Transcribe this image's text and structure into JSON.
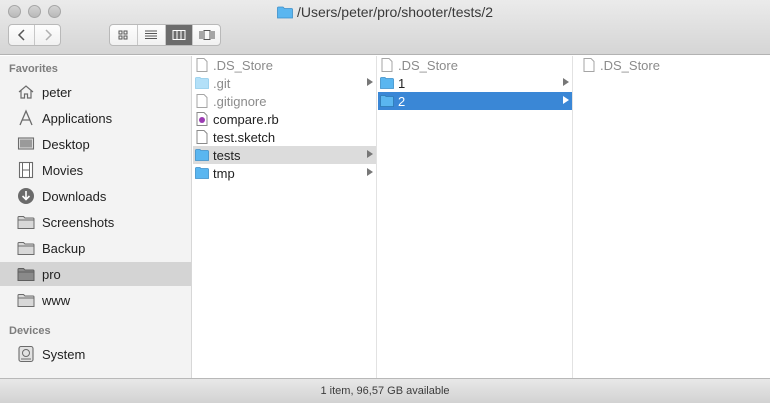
{
  "window": {
    "title": "/Users/peter/pro/shooter/tests/2"
  },
  "toolbar": {
    "nav": [
      {
        "icon": "chevron-left-icon"
      },
      {
        "icon": "chevron-right-icon"
      }
    ],
    "views": [
      {
        "icon": "icon-view-icon",
        "active": false
      },
      {
        "icon": "list-view-icon",
        "active": false
      },
      {
        "icon": "column-view-icon",
        "active": true
      },
      {
        "icon": "cover-flow-icon",
        "active": false
      }
    ]
  },
  "sidebar": {
    "favorites_label": "Favorites",
    "favorites": [
      {
        "label": "peter",
        "icon": "home-icon"
      },
      {
        "label": "Applications",
        "icon": "applications-icon"
      },
      {
        "label": "Desktop",
        "icon": "desktop-icon"
      },
      {
        "label": "Movies",
        "icon": "movies-icon"
      },
      {
        "label": "Downloads",
        "icon": "downloads-icon"
      },
      {
        "label": "Screenshots",
        "icon": "folder-icon"
      },
      {
        "label": "Backup",
        "icon": "folder-icon"
      },
      {
        "label": "pro",
        "icon": "folder-icon",
        "selected": true
      },
      {
        "label": "www",
        "icon": "folder-icon"
      }
    ],
    "devices_label": "Devices",
    "devices": [
      {
        "label": "System",
        "icon": "hard-drive-icon"
      }
    ]
  },
  "columns": [
    [
      {
        "name": ".DS_Store",
        "kind": "file",
        "dim": true
      },
      {
        "name": ".git",
        "kind": "folder-light",
        "dim": true,
        "has_children": true
      },
      {
        "name": ".gitignore",
        "kind": "file",
        "dim": true
      },
      {
        "name": "compare.rb",
        "kind": "ruby-file"
      },
      {
        "name": "test.sketch",
        "kind": "file"
      },
      {
        "name": "tests",
        "kind": "folder",
        "has_children": true,
        "selected": "grey"
      },
      {
        "name": "tmp",
        "kind": "folder",
        "has_children": true
      }
    ],
    [
      {
        "name": ".DS_Store",
        "kind": "file",
        "dim": true
      },
      {
        "name": "1",
        "kind": "folder",
        "has_children": true
      },
      {
        "name": "2",
        "kind": "folder",
        "has_children": true,
        "selected": "blue"
      }
    ],
    [
      {
        "name": ".DS_Store",
        "kind": "file",
        "dim": true
      }
    ]
  ],
  "status": {
    "text": "1 item, 96,57 GB available"
  },
  "colors": {
    "selection_blue": "#3a87d6",
    "folder_blue": "#5ab6f0"
  }
}
